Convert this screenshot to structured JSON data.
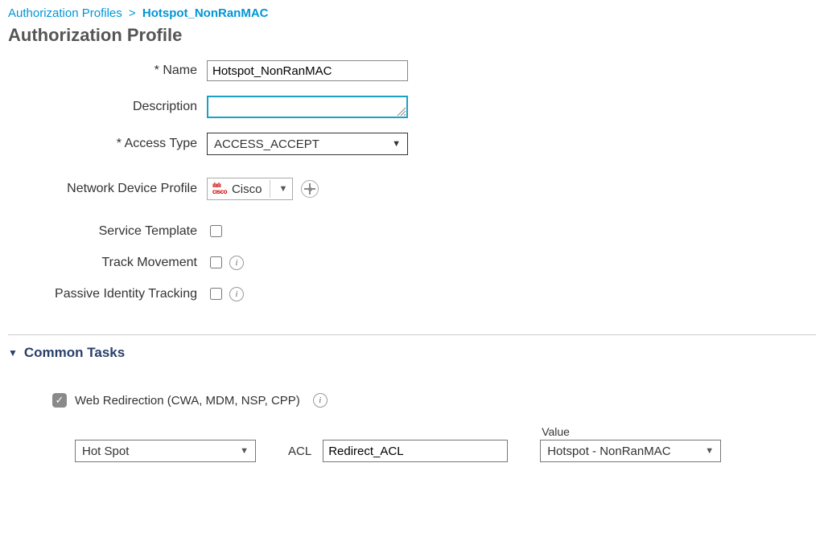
{
  "breadcrumb": {
    "parent": "Authorization Profiles",
    "current": "Hotspot_NonRanMAC"
  },
  "page_title": "Authorization Profile",
  "fields": {
    "name_label": "* Name",
    "name_value": "Hotspot_NonRanMAC",
    "description_label": "Description",
    "description_value": "",
    "access_type_label": "* Access Type",
    "access_type_value": "ACCESS_ACCEPT",
    "ndp_label": "Network Device Profile",
    "ndp_value": "Cisco",
    "service_template_label": "Service Template",
    "service_template_checked": false,
    "track_movement_label": "Track Movement",
    "track_movement_checked": false,
    "passive_identity_label": "Passive Identity Tracking",
    "passive_identity_checked": false
  },
  "common_tasks": {
    "header": "Common Tasks",
    "web_redirection_label": "Web Redirection (CWA, MDM, NSP, CPP)",
    "web_redirection_checked": true,
    "redirect_type": "Hot Spot",
    "acl_label": "ACL",
    "acl_value": "Redirect_ACL",
    "value_label": "Value",
    "value_value": "Hotspot - NonRanMAC"
  }
}
